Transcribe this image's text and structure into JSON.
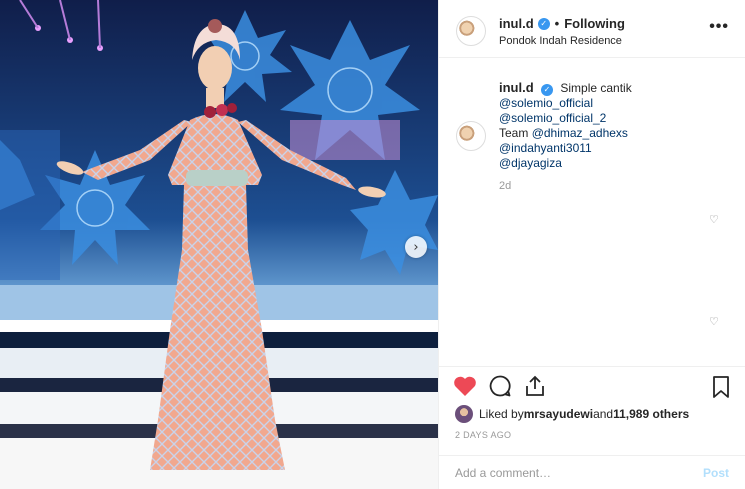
{
  "header": {
    "username": "inul.d",
    "verified_glyph": "✓",
    "separator": "•",
    "follow_status": "Following",
    "location": "Pondok Indah Residence",
    "more_glyph": "•••"
  },
  "photo": {
    "next_glyph": "›"
  },
  "caption": {
    "username": "inul.d",
    "text": "Simple cantik",
    "mentions": [
      "@solemio_official",
      "@solemio_official_2"
    ],
    "team_prefix": "Team ",
    "team_mention": "@dhimaz_adhexs",
    "more_mentions": [
      "@indahyanti3011",
      "@djayagiza"
    ],
    "time": "2d"
  },
  "likes": {
    "prefix": "Liked by ",
    "user": "mrsayudewi",
    "middle": " and ",
    "count": "11,989 others"
  },
  "post_time": "2 DAYS AGO",
  "comment_box": {
    "placeholder": "Add a comment…",
    "post_label": "Post"
  },
  "colors": {
    "like_red": "#ed4956",
    "link_blue": "#003569",
    "verified_blue": "#3897f0",
    "post_disabled": "#b2dffc"
  },
  "icons": [
    "heart-icon",
    "comment-icon",
    "share-icon",
    "bookmark-icon",
    "verified-icon",
    "more-icon",
    "chevron-right-icon"
  ]
}
